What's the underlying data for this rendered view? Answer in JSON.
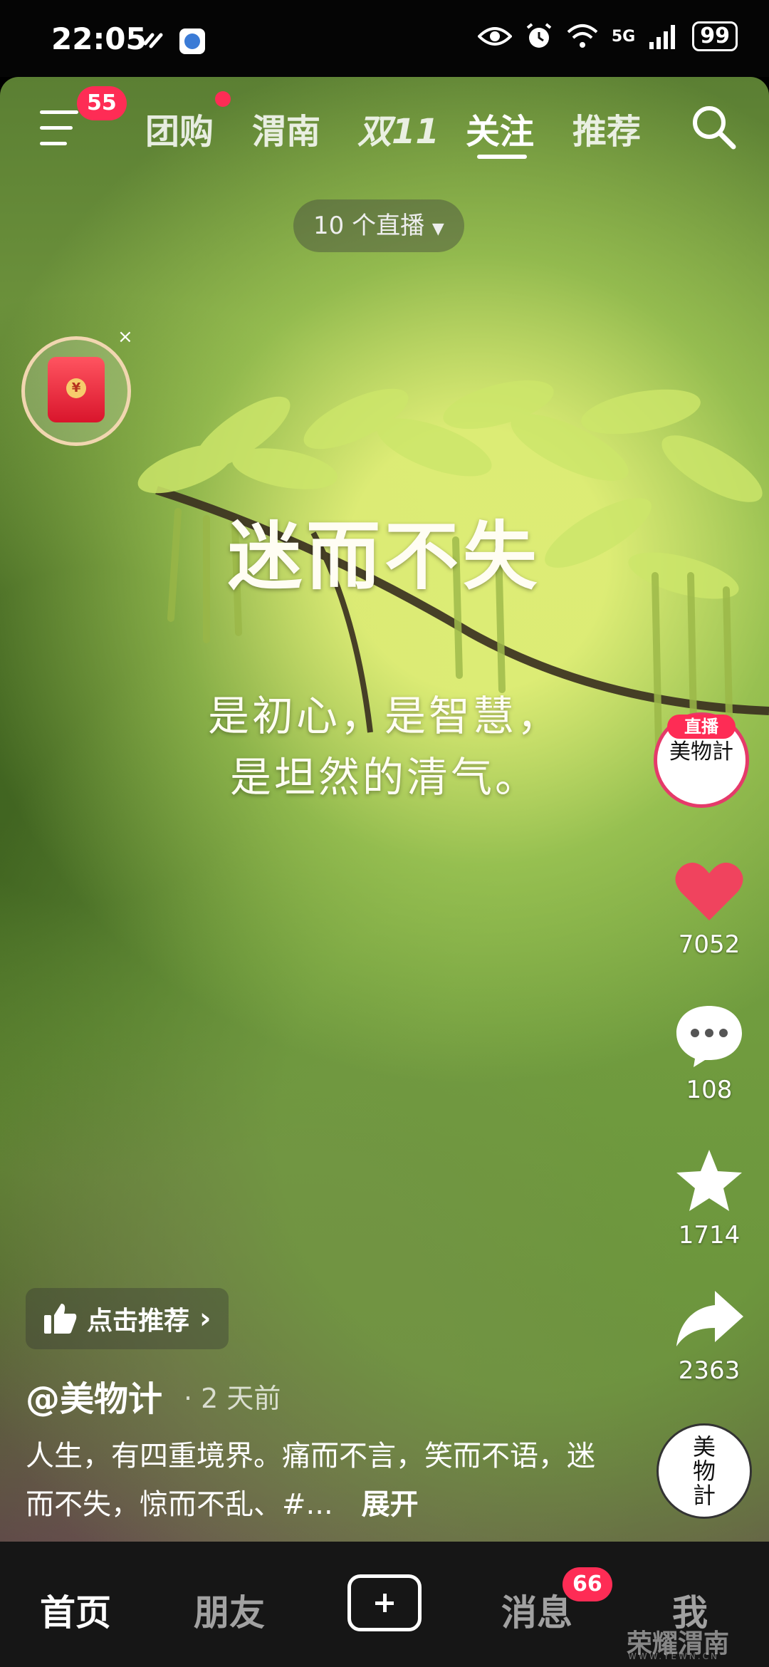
{
  "status_bar": {
    "time": "22:05",
    "network": "5G",
    "battery": "99"
  },
  "top_nav": {
    "menu_badge": "55",
    "tabs": [
      {
        "label": "团购",
        "has_dot": true
      },
      {
        "label": "渭南"
      },
      {
        "label": "双11"
      },
      {
        "label": "关注",
        "active": true
      },
      {
        "label": "推荐"
      }
    ]
  },
  "live_pill": {
    "label": "10 个直播"
  },
  "video": {
    "title": "迷而不失",
    "line1": "是初心，是智慧，",
    "line2": "是坦然的清气。"
  },
  "side_rail": {
    "live_tag": "直播",
    "avatar_text": "美物計",
    "likes": "7052",
    "comments": "108",
    "favorites": "1714",
    "shares": "2363",
    "music_disc_text": "美物計"
  },
  "recommend_chip": {
    "label": "点击推荐"
  },
  "post": {
    "author": "@美物计",
    "time_ago": "· 2 天前",
    "description": "人生，有四重境界。痛而不言，笑而不语，迷而不失，惊而不乱、#...",
    "expand_label": "展开"
  },
  "bottom_nav": {
    "items": [
      {
        "label": "首页",
        "active": true
      },
      {
        "label": "朋友"
      },
      {
        "label": "消息",
        "badge": "66"
      },
      {
        "label": "我"
      }
    ]
  },
  "watermark": {
    "text": "荣耀渭南",
    "sub": "WWW.YEWN.CN"
  },
  "colors": {
    "accent": "#fe2c55",
    "heart": "#f0435e"
  }
}
